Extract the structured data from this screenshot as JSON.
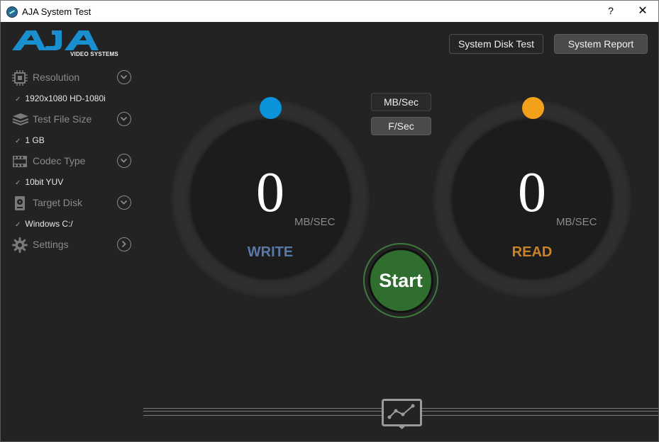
{
  "window": {
    "title": "AJA System Test",
    "help_label": "?",
    "close_label": "✕"
  },
  "logo": {
    "brand": "AJA",
    "subtitle": "VIDEO SYSTEMS"
  },
  "sidebar": {
    "items": [
      {
        "label": "Resolution",
        "value": "1920x1080 HD-1080i",
        "icon": "resolution-icon",
        "chevron": "chevron-down-icon"
      },
      {
        "label": "Test File Size",
        "value": "1 GB",
        "icon": "file-size-icon",
        "chevron": "chevron-down-icon"
      },
      {
        "label": "Codec Type",
        "value": "10bit YUV",
        "icon": "codec-icon",
        "chevron": "chevron-down-icon"
      },
      {
        "label": "Target Disk",
        "value": "Windows C:/",
        "icon": "disk-icon",
        "chevron": "chevron-down-icon"
      },
      {
        "label": "Settings",
        "icon": "gear-icon",
        "chevron": "chevron-right-icon"
      }
    ],
    "check_mark": "✓"
  },
  "toolbar": {
    "system_disk_test": "System Disk Test",
    "system_report": "System Report"
  },
  "units": {
    "mb_sec": "MB/Sec",
    "f_sec": "F/Sec",
    "selected": "MB/Sec"
  },
  "write": {
    "value": "0",
    "unit": "MB/SEC",
    "label": "WRITE",
    "color": "#0a93d9",
    "label_color": "#5878a8"
  },
  "read": {
    "value": "0",
    "unit": "MB/SEC",
    "label": "READ",
    "color": "#f3a11a",
    "label_color": "#c8822a"
  },
  "start": {
    "label": "Start",
    "color": "#2f6e2f"
  },
  "graph_toggle": {
    "icon": "graph-icon"
  }
}
